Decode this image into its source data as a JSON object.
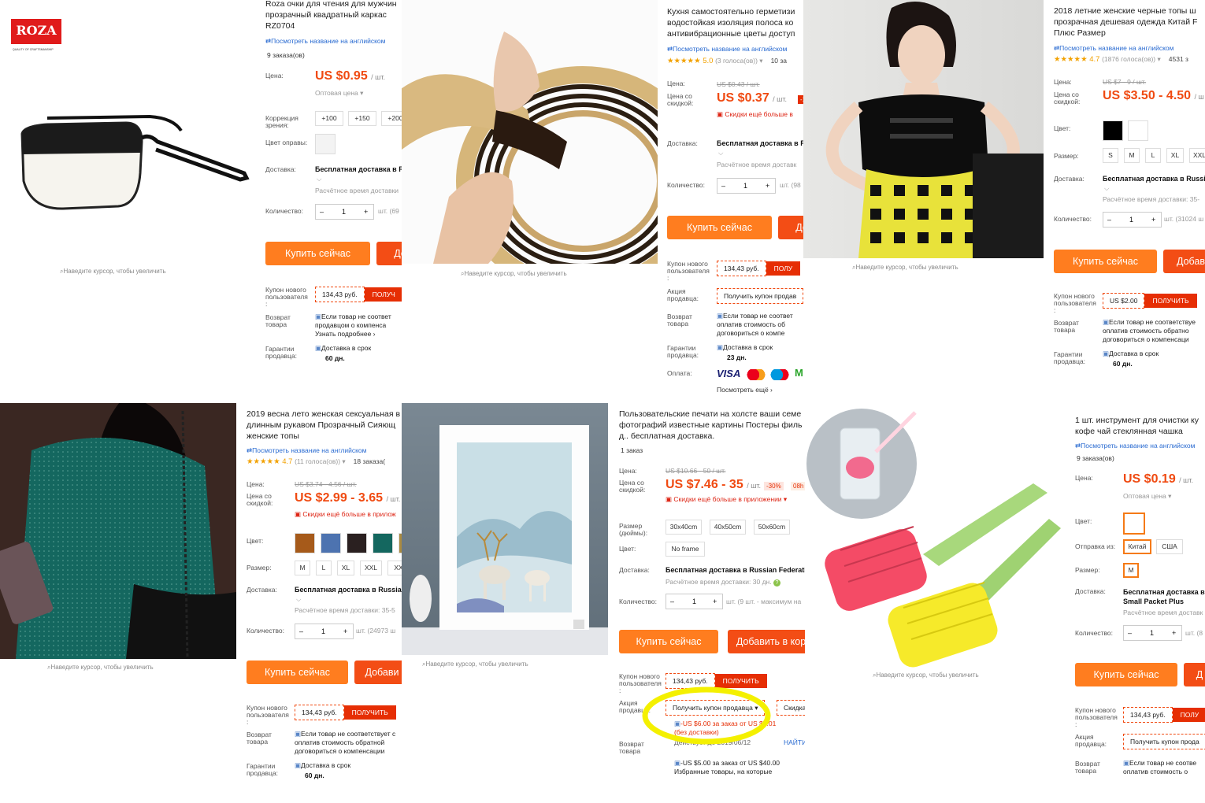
{
  "common": {
    "translate": "Посмотреть название на английском",
    "zoom_hint": "Наведите курсор, чтобы увеличить",
    "price_label": "Цена:",
    "disc_price_label": "Цена со\nскидкой:",
    "delivery_label": "Доставка:",
    "quantity_label": "Количество:",
    "color_label": "Цвет:",
    "size_label": "Размер:",
    "buy_now": "Купить сейчас",
    "add_to_cart_short": "Доба",
    "new_user_coupon_label": "Купон нового\nпользователя\n:",
    "get": "ПОЛУЧИТЬ",
    "return_label": "Возврат\nтовара",
    "guarantee_label": "Гарантии\nпродавца:",
    "seller_promo_label": "Акция\nпродавца:",
    "in_app": "Скидки ещё больше в приложении",
    "estimate": "Расчётное время доставки",
    "free_shipping_russia": "Бесплатная доставка в Russia",
    "unit": "/ шт.",
    "wholesale": "Оптовая цена ▾",
    "on_time_delivery": "Доставка в срок"
  },
  "panel1": {
    "logo_text": "ROZA",
    "logo_sub": "QUALITY OF CRAFTSMANSHIP",
    "title": "Roza очки для чтения для мужчин\nпрозрачный квадратный каркас\nRZ0704",
    "orders": "9 заказа(ов)",
    "price": "US $0.95",
    "correction_label": "Коррекция\nзрения:",
    "corrections": [
      "+100",
      "+150",
      "+200"
    ],
    "frame_color_label": "Цвет оправы:",
    "delivery": "Бесплатная доставка в R",
    "estimate": "Расчётное время доставки",
    "qty": "1",
    "stock": "шт. (69",
    "add_btn": "До",
    "coupon": "134,43 руб.",
    "get": "ПОЛУЧ",
    "return_text": "Если товар не соответ\nпродавцом о компенса\nУзнать подробнее ›",
    "delivery_days": "60 дн."
  },
  "panel2": {
    "title": "Кухня самостоятельно герметизи\nводостойкая изоляция полоса ко\nантивибрационные цветы доступ",
    "rating": "★★★★★ 5.0",
    "votes": "(3 голоса(ов)) ▾",
    "orders": "10 за",
    "old_price": "US $0.43 / шт.",
    "price": "US $0.37",
    "discount": "-1",
    "in_app": "Скидки ещё больше в",
    "delivery": "Бесплатная доставка в R",
    "estimate": "Расчётное время доставк",
    "qty": "1",
    "stock": "шт. (98",
    "add_btn": "До",
    "coupon": "134,43 руб.",
    "get": "ПОЛУ",
    "seller_coupon": "Получить купон продав",
    "return_text": "Если товар не соответ\nоплатив стоимость об\nдоговориться о компе",
    "delivery_days": "23 дн.",
    "payment_label": "Оплата:",
    "payments": [
      "VISA",
      "MC",
      "Maestro",
      "M"
    ],
    "more": "Посмотреть ещё ›"
  },
  "panel3": {
    "title": "2018 летние женские черные топы ш\nпрозрачная дешевая одежда Китай F\nПлюс Размер",
    "rating": "★★★★★ 4.7",
    "votes": "(1876 голоса(ов)) ▾",
    "orders": "4531 з",
    "old_price": "US $7 - 9 / шт.",
    "price": "US $3.50 - 4.50",
    "unit_short": "/ ш",
    "sizes": [
      "S",
      "M",
      "L",
      "XL",
      "XXL"
    ],
    "delivery": "Бесплатная доставка в Russia",
    "estimate": "Расчётное время доставки: 35-",
    "qty": "1",
    "stock": "шт. (31024 ш",
    "add_btn": "Добав",
    "coupon": "US $2.00",
    "get": "ПОЛУЧИТЬ",
    "return_text": "Если товар не соответствуе\nоплатив стоимость обратно\nдоговориться о компенсаци",
    "delivery_days": "60 дн."
  },
  "panel4": {
    "title": "2019 весна лето женская сексуальная в\nдлинным рукавом Прозрачный Сияющ\nженские топы",
    "rating": "★★★★★ 4.7",
    "votes": "(11 голоса(ов)) ▾",
    "orders": "18 заказа(",
    "old_price": "US $3.74 - 4.56 / шт.",
    "price": "US $2.99 - 3.65",
    "in_app": "Скидки ещё больше в прилож",
    "sizes": [
      "M",
      "L",
      "XL",
      "XXL",
      "XX"
    ],
    "delivery": "Бесплатная доставка в Russian",
    "estimate": "Расчётное время доставки: 35-5",
    "qty": "1",
    "stock": "шт. (24973 ш",
    "add_btn": "Добави",
    "coupon": "134,43 руб.",
    "get": "ПОЛУЧИТЬ",
    "return_text": "Если товар не соответствует с\nоплатив стоимость обратной\nдоговориться о компенсации",
    "delivery_days": "60 дн."
  },
  "panel5": {
    "title": "Пользовательские печати на холсте ваши семе\nфотографий известные картины Постеры филь\nд.. бесплатная доставка.",
    "orders": "1 заказ",
    "old_price": "US $10.66 - 50 / шт.",
    "price": "US $7.46 - 35",
    "discount": "-30%",
    "timer": "08h",
    "in_app": "Скидки ещё больше в приложении ▾",
    "size_label": "Размер\n(дюймы):",
    "sizes": [
      "30x40cm",
      "40x50cm",
      "50x60cm"
    ],
    "frame": "No frame",
    "delivery": "Бесплатная доставка в Russian Federatio",
    "estimate": "Расчётное время доставки: 30 дн.",
    "qty": "1",
    "stock": "шт. (9 шт. - максимум на",
    "add_btn": "Добавить в кор",
    "coupon": "134,43 руб.",
    "get": "ПОЛУЧИТЬ",
    "seller_coupon": "Получить купон продавца ▾",
    "discount_short": "Скидка",
    "offer1": "-US $6.00 за заказ от US $6.01\n(без доставки)",
    "valid": "Действует до 2019/06/12",
    "get_short": "НАЙТИ",
    "offer2": "-US $5.00 за заказ от US $40.00\nИзбранные товары, на которые"
  },
  "panel6": {
    "title": "1 шт. инструмент для очистки ку\nкофе чай стеклянная чашка",
    "orders": "9 заказа(ов)",
    "price": "US $0.19",
    "unit": "/ шт.",
    "ship_from_label": "Отправка из:",
    "ship_from": [
      "Китай",
      "США"
    ],
    "size": "M",
    "delivery": "Бесплатная доставка в\nSmall Packet Plus",
    "estimate": "Расчётное время доставк",
    "qty": "1",
    "stock": "шт. (8",
    "add_btn": "Д",
    "coupon": "134,43 руб.",
    "get": "ПОЛУ",
    "seller_coupon": "Получить купон прода",
    "return_text": "Если товар не соотве\nоплатив стоимость о"
  },
  "colors": {
    "accent_orange": "#ff7d1f",
    "price_red": "#f04a11",
    "get_red": "#e62e04",
    "highlight_yellow": "#f4f000",
    "link_blue": "#2a6bd1"
  }
}
